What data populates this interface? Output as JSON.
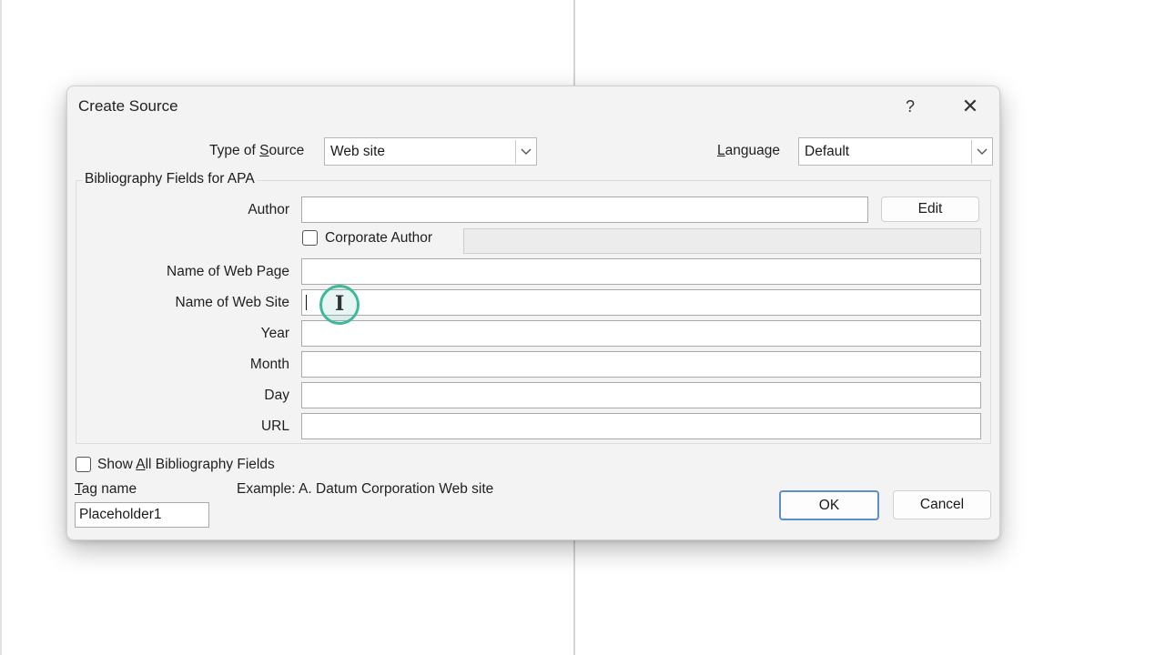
{
  "dialog": {
    "title": "Create Source",
    "help_label": "?",
    "close_label": "✕"
  },
  "source": {
    "type_label_pre": "Type of ",
    "type_label_u": "S",
    "type_label_post": "ource",
    "type_value": "Web site",
    "language_label_u": "L",
    "language_label_post": "anguage",
    "language_value": "Default"
  },
  "bibliography": {
    "group_title": "Bibliography Fields for APA",
    "author_label": "Author",
    "author_value": "",
    "edit_label": "Edit",
    "corporate_author_label": "Corporate Author",
    "corporate_author_checked": false,
    "fields": [
      {
        "label": "Name of Web Page",
        "value": ""
      },
      {
        "label": "Name of Web Site",
        "value": ""
      },
      {
        "label": "Year",
        "value": ""
      },
      {
        "label": "Month",
        "value": ""
      },
      {
        "label": "Day",
        "value": ""
      },
      {
        "label": "URL",
        "value": ""
      }
    ]
  },
  "footer": {
    "show_all_pre": "Show ",
    "show_all_u": "A",
    "show_all_post": "ll Bibliography Fields",
    "show_all_checked": false,
    "tag_label_u": "T",
    "tag_label_post": "ag name",
    "tag_value": "Placeholder1",
    "example_text": "Example: A. Datum Corporation Web site",
    "ok_label": "OK",
    "cancel_label": "Cancel"
  },
  "icons": {
    "dropdown": "chevron-down-icon",
    "help": "help-icon",
    "close": "close-icon",
    "cursor": "text-cursor-icon"
  }
}
